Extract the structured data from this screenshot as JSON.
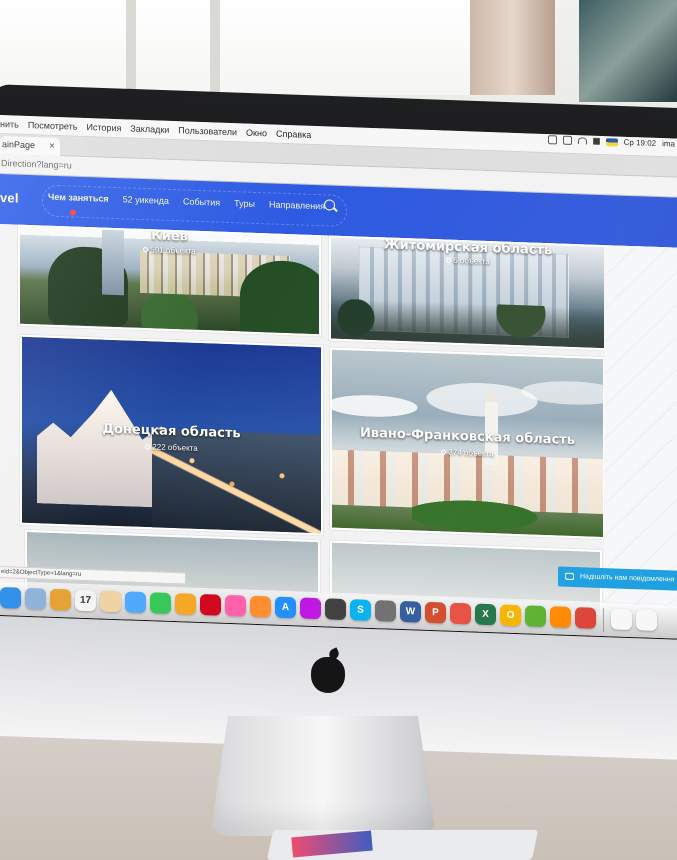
{
  "menu_bar": {
    "items": [
      "нить",
      "Посмотреть",
      "История",
      "Закладки",
      "Пользователи",
      "Окно",
      "Справка"
    ],
    "clock": "Ср 19:02",
    "user": "ima"
  },
  "browser": {
    "tab_title": "ainPage",
    "tab_close": "×",
    "address": "Direction?lang=ru",
    "status_url": "eld=2&ObjectType=1&lang=ru"
  },
  "site": {
    "logo": "vel",
    "nav": [
      {
        "label": "Чем заняться",
        "active": true
      },
      {
        "label": "52 уикенда",
        "active": false
      },
      {
        "label": "События",
        "active": false
      },
      {
        "label": "Туры",
        "active": false
      },
      {
        "label": "Направления",
        "active": false
      }
    ],
    "cards": [
      {
        "title": "Киев",
        "count": "591 объекта"
      },
      {
        "title": "Житомирская область",
        "count": "6 объекта"
      },
      {
        "title": "Донецкая область",
        "count": "222 объекта"
      },
      {
        "title": "Ивано-Франковская область",
        "count": "374 объекта"
      }
    ],
    "chat_label": "Надішліть нам повідомлення"
  },
  "dock": {
    "apps": [
      {
        "name": "safari-icon",
        "label": "",
        "color": "#2f8ee8"
      },
      {
        "name": "preview-icon",
        "label": "",
        "color": "#8fb2d9"
      },
      {
        "name": "notes-icon",
        "label": "",
        "color": "#e7a236"
      },
      {
        "name": "calendar-icon",
        "label": "17",
        "color": "#f4f4f4"
      },
      {
        "name": "photos-icon",
        "label": "",
        "color": "#f1d2a2"
      },
      {
        "name": "messages-icon",
        "label": "",
        "color": "#4da9ff"
      },
      {
        "name": "facetime-icon",
        "label": "",
        "color": "#34c759"
      },
      {
        "name": "photos-flower-icon",
        "label": "",
        "color": "#f5a623"
      },
      {
        "name": "photo-booth-icon",
        "label": "",
        "color": "#d0021b"
      },
      {
        "name": "itunes-icon",
        "label": "",
        "color": "#ff5ea8"
      },
      {
        "name": "ibooks-icon",
        "label": "",
        "color": "#ff8b2c"
      },
      {
        "name": "app-store-icon",
        "label": "A",
        "color": "#1a8cff"
      },
      {
        "name": "system-preferences-icon",
        "label": "",
        "color": "#bd10e0"
      },
      {
        "name": "pen-icon",
        "label": "",
        "color": "#3a3a3a"
      },
      {
        "name": "skype-icon",
        "label": "S",
        "color": "#00aff0"
      },
      {
        "name": "utility-icon",
        "label": "",
        "color": "#6b6b6b"
      },
      {
        "name": "word-icon",
        "label": "W",
        "color": "#2b579a"
      },
      {
        "name": "powerpoint-icon",
        "label": "P",
        "color": "#d24726"
      },
      {
        "name": "flag-icon",
        "label": "",
        "color": "#e64c3c"
      },
      {
        "name": "excel-icon",
        "label": "X",
        "color": "#217346"
      },
      {
        "name": "outlook-icon",
        "label": "O",
        "color": "#f5b400"
      },
      {
        "name": "torrent-icon",
        "label": "",
        "color": "#5bb12f"
      },
      {
        "name": "vlc-icon",
        "label": "",
        "color": "#ff8800"
      },
      {
        "name": "chrome-icon",
        "label": "",
        "color": "#db4437"
      },
      {
        "name": "document-icon",
        "label": "",
        "color": "#f7f7f7"
      },
      {
        "name": "document-icon-2",
        "label": "",
        "color": "#f7f7f7"
      }
    ]
  }
}
